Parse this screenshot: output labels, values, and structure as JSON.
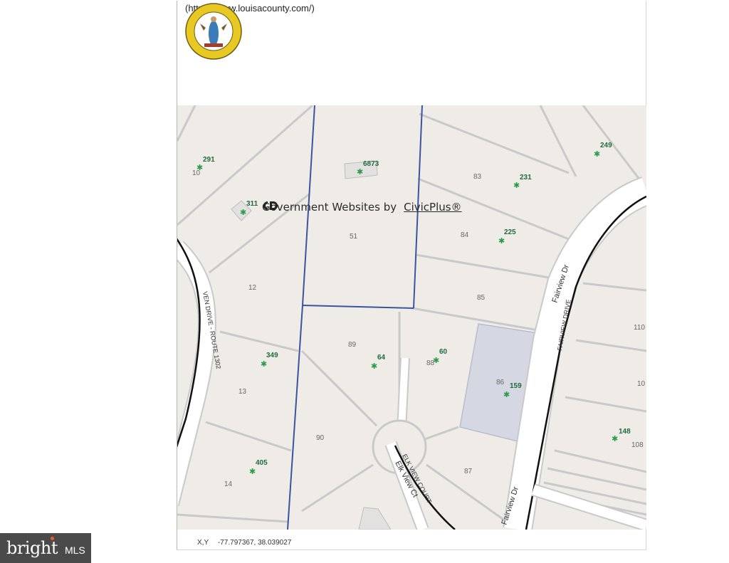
{
  "header": {
    "url_text": "(https://www.louisacounty.com/)",
    "seal_alt": "County of Louisa Virginia seal"
  },
  "map": {
    "banner_prefix": "Government Websites by",
    "banner_brand": "CivicPlus®",
    "parcel_labels": [
      "10",
      "51",
      "83",
      "84",
      "12",
      "85",
      "110",
      "89",
      "88",
      "86",
      "13",
      "10",
      "90",
      "108",
      "87",
      "14"
    ],
    "address_labels": [
      "291",
      "6873",
      "231",
      "249",
      "311",
      "225",
      "349",
      "64",
      "60",
      "159",
      "148",
      "405"
    ],
    "road_labels": [
      "VEN DRIVE - ROUTE 1302",
      "Fairview Dr",
      "FAIRVIEW DRIVE",
      "ELK VIEW COURT",
      "Elk View Ct",
      "Fairview Dr"
    ]
  },
  "footer": {
    "xy_label": "X,Y",
    "xy_value": "-77.797367, 38.039027"
  },
  "watermark": {
    "part1": "bright",
    "part2": "MLS"
  },
  "colors": {
    "parcel_fill": "#efece8",
    "parcel_line": "#c9c9c9",
    "road_fill": "#ffffff",
    "road_edge": "#111111",
    "boundary": "#3a55a0",
    "address_green": "#2a9b49",
    "highlight": "#d4d6e0"
  }
}
